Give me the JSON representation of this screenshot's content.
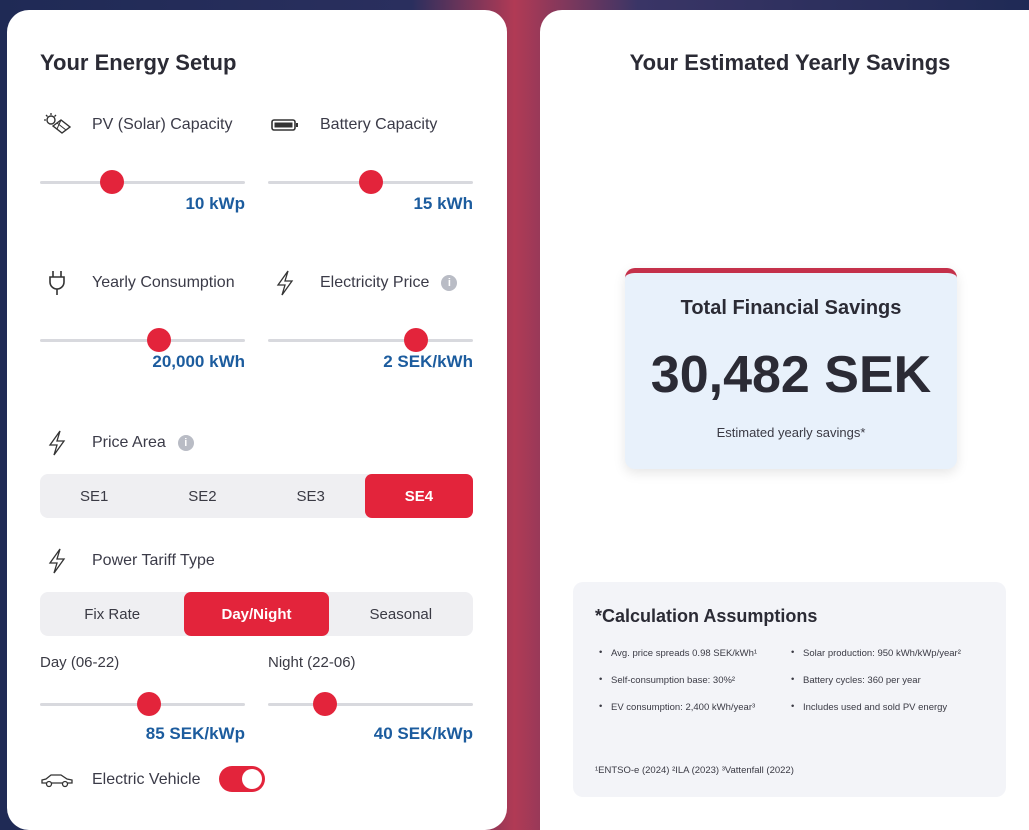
{
  "left": {
    "title": "Your Energy Setup",
    "pv": {
      "label": "PV (Solar) Capacity",
      "value": "10 kWp",
      "icon": "solar-panel-icon",
      "level": 0.35
    },
    "battery": {
      "label": "Battery Capacity",
      "value": "15 kWh",
      "icon": "battery-icon",
      "level": 0.5
    },
    "consumption": {
      "label": "Yearly Consumption",
      "value": "20,000 kWh",
      "icon": "plug-icon",
      "level": 0.58
    },
    "price": {
      "label": "Electricity Price",
      "value": "2 SEK/kWh",
      "icon": "lightning-icon",
      "level": 0.72
    },
    "price_area": {
      "label": "Price Area",
      "icon": "lightning-icon",
      "options": [
        "SE1",
        "SE2",
        "SE3",
        "SE4"
      ],
      "selected": "SE4"
    },
    "tariff": {
      "label": "Power Tariff Type",
      "icon": "lightning-icon",
      "options": [
        "Fix Rate",
        "Day/Night",
        "Seasonal"
      ],
      "selected": "Day/Night"
    },
    "day": {
      "label": "Day (06-22)",
      "value": "85 SEK/kWp",
      "level": 0.53
    },
    "night": {
      "label": "Night (22-06)",
      "value": "40 SEK/kWp",
      "level": 0.28
    },
    "ev": {
      "label": "Electric Vehicle",
      "icon": "car-icon",
      "on": true
    },
    "info_glyph": "i"
  },
  "right": {
    "title": "Your Estimated Yearly Savings",
    "card": {
      "heading": "Total Financial Savings",
      "amount": "30,482 SEK",
      "sub": "Estimated yearly savings*"
    },
    "assumptions": {
      "title": "*Calculation Assumptions",
      "left_items": [
        "Avg. price spreads 0.98 SEK/kWh¹",
        "Self-consumption base: 30%²",
        "EV consumption: 2,400 kWh/year³"
      ],
      "right_items": [
        "Solar production: 950 kWh/kWp/year²",
        "Battery cycles: 360 per year",
        "Includes used and sold PV energy"
      ],
      "refs": "¹ENTSO-e (2024)   ²ILA (2023)   ³Vattenfall (2022)"
    }
  },
  "colors": {
    "accent": "#e3243b",
    "value": "#1c5c9e"
  }
}
